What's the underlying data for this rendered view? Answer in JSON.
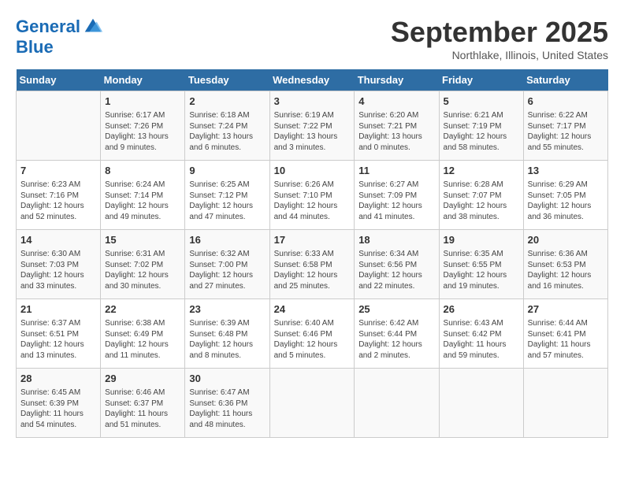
{
  "logo": {
    "line1": "General",
    "line2": "Blue"
  },
  "title": "September 2025",
  "location": "Northlake, Illinois, United States",
  "weekdays": [
    "Sunday",
    "Monday",
    "Tuesday",
    "Wednesday",
    "Thursday",
    "Friday",
    "Saturday"
  ],
  "weeks": [
    [
      {
        "day": "",
        "info": ""
      },
      {
        "day": "1",
        "info": "Sunrise: 6:17 AM\nSunset: 7:26 PM\nDaylight: 13 hours\nand 9 minutes."
      },
      {
        "day": "2",
        "info": "Sunrise: 6:18 AM\nSunset: 7:24 PM\nDaylight: 13 hours\nand 6 minutes."
      },
      {
        "day": "3",
        "info": "Sunrise: 6:19 AM\nSunset: 7:22 PM\nDaylight: 13 hours\nand 3 minutes."
      },
      {
        "day": "4",
        "info": "Sunrise: 6:20 AM\nSunset: 7:21 PM\nDaylight: 13 hours\nand 0 minutes."
      },
      {
        "day": "5",
        "info": "Sunrise: 6:21 AM\nSunset: 7:19 PM\nDaylight: 12 hours\nand 58 minutes."
      },
      {
        "day": "6",
        "info": "Sunrise: 6:22 AM\nSunset: 7:17 PM\nDaylight: 12 hours\nand 55 minutes."
      }
    ],
    [
      {
        "day": "7",
        "info": "Sunrise: 6:23 AM\nSunset: 7:16 PM\nDaylight: 12 hours\nand 52 minutes."
      },
      {
        "day": "8",
        "info": "Sunrise: 6:24 AM\nSunset: 7:14 PM\nDaylight: 12 hours\nand 49 minutes."
      },
      {
        "day": "9",
        "info": "Sunrise: 6:25 AM\nSunset: 7:12 PM\nDaylight: 12 hours\nand 47 minutes."
      },
      {
        "day": "10",
        "info": "Sunrise: 6:26 AM\nSunset: 7:10 PM\nDaylight: 12 hours\nand 44 minutes."
      },
      {
        "day": "11",
        "info": "Sunrise: 6:27 AM\nSunset: 7:09 PM\nDaylight: 12 hours\nand 41 minutes."
      },
      {
        "day": "12",
        "info": "Sunrise: 6:28 AM\nSunset: 7:07 PM\nDaylight: 12 hours\nand 38 minutes."
      },
      {
        "day": "13",
        "info": "Sunrise: 6:29 AM\nSunset: 7:05 PM\nDaylight: 12 hours\nand 36 minutes."
      }
    ],
    [
      {
        "day": "14",
        "info": "Sunrise: 6:30 AM\nSunset: 7:03 PM\nDaylight: 12 hours\nand 33 minutes."
      },
      {
        "day": "15",
        "info": "Sunrise: 6:31 AM\nSunset: 7:02 PM\nDaylight: 12 hours\nand 30 minutes."
      },
      {
        "day": "16",
        "info": "Sunrise: 6:32 AM\nSunset: 7:00 PM\nDaylight: 12 hours\nand 27 minutes."
      },
      {
        "day": "17",
        "info": "Sunrise: 6:33 AM\nSunset: 6:58 PM\nDaylight: 12 hours\nand 25 minutes."
      },
      {
        "day": "18",
        "info": "Sunrise: 6:34 AM\nSunset: 6:56 PM\nDaylight: 12 hours\nand 22 minutes."
      },
      {
        "day": "19",
        "info": "Sunrise: 6:35 AM\nSunset: 6:55 PM\nDaylight: 12 hours\nand 19 minutes."
      },
      {
        "day": "20",
        "info": "Sunrise: 6:36 AM\nSunset: 6:53 PM\nDaylight: 12 hours\nand 16 minutes."
      }
    ],
    [
      {
        "day": "21",
        "info": "Sunrise: 6:37 AM\nSunset: 6:51 PM\nDaylight: 12 hours\nand 13 minutes."
      },
      {
        "day": "22",
        "info": "Sunrise: 6:38 AM\nSunset: 6:49 PM\nDaylight: 12 hours\nand 11 minutes."
      },
      {
        "day": "23",
        "info": "Sunrise: 6:39 AM\nSunset: 6:48 PM\nDaylight: 12 hours\nand 8 minutes."
      },
      {
        "day": "24",
        "info": "Sunrise: 6:40 AM\nSunset: 6:46 PM\nDaylight: 12 hours\nand 5 minutes."
      },
      {
        "day": "25",
        "info": "Sunrise: 6:42 AM\nSunset: 6:44 PM\nDaylight: 12 hours\nand 2 minutes."
      },
      {
        "day": "26",
        "info": "Sunrise: 6:43 AM\nSunset: 6:42 PM\nDaylight: 11 hours\nand 59 minutes."
      },
      {
        "day": "27",
        "info": "Sunrise: 6:44 AM\nSunset: 6:41 PM\nDaylight: 11 hours\nand 57 minutes."
      }
    ],
    [
      {
        "day": "28",
        "info": "Sunrise: 6:45 AM\nSunset: 6:39 PM\nDaylight: 11 hours\nand 54 minutes."
      },
      {
        "day": "29",
        "info": "Sunrise: 6:46 AM\nSunset: 6:37 PM\nDaylight: 11 hours\nand 51 minutes."
      },
      {
        "day": "30",
        "info": "Sunrise: 6:47 AM\nSunset: 6:36 PM\nDaylight: 11 hours\nand 48 minutes."
      },
      {
        "day": "",
        "info": ""
      },
      {
        "day": "",
        "info": ""
      },
      {
        "day": "",
        "info": ""
      },
      {
        "day": "",
        "info": ""
      }
    ]
  ]
}
